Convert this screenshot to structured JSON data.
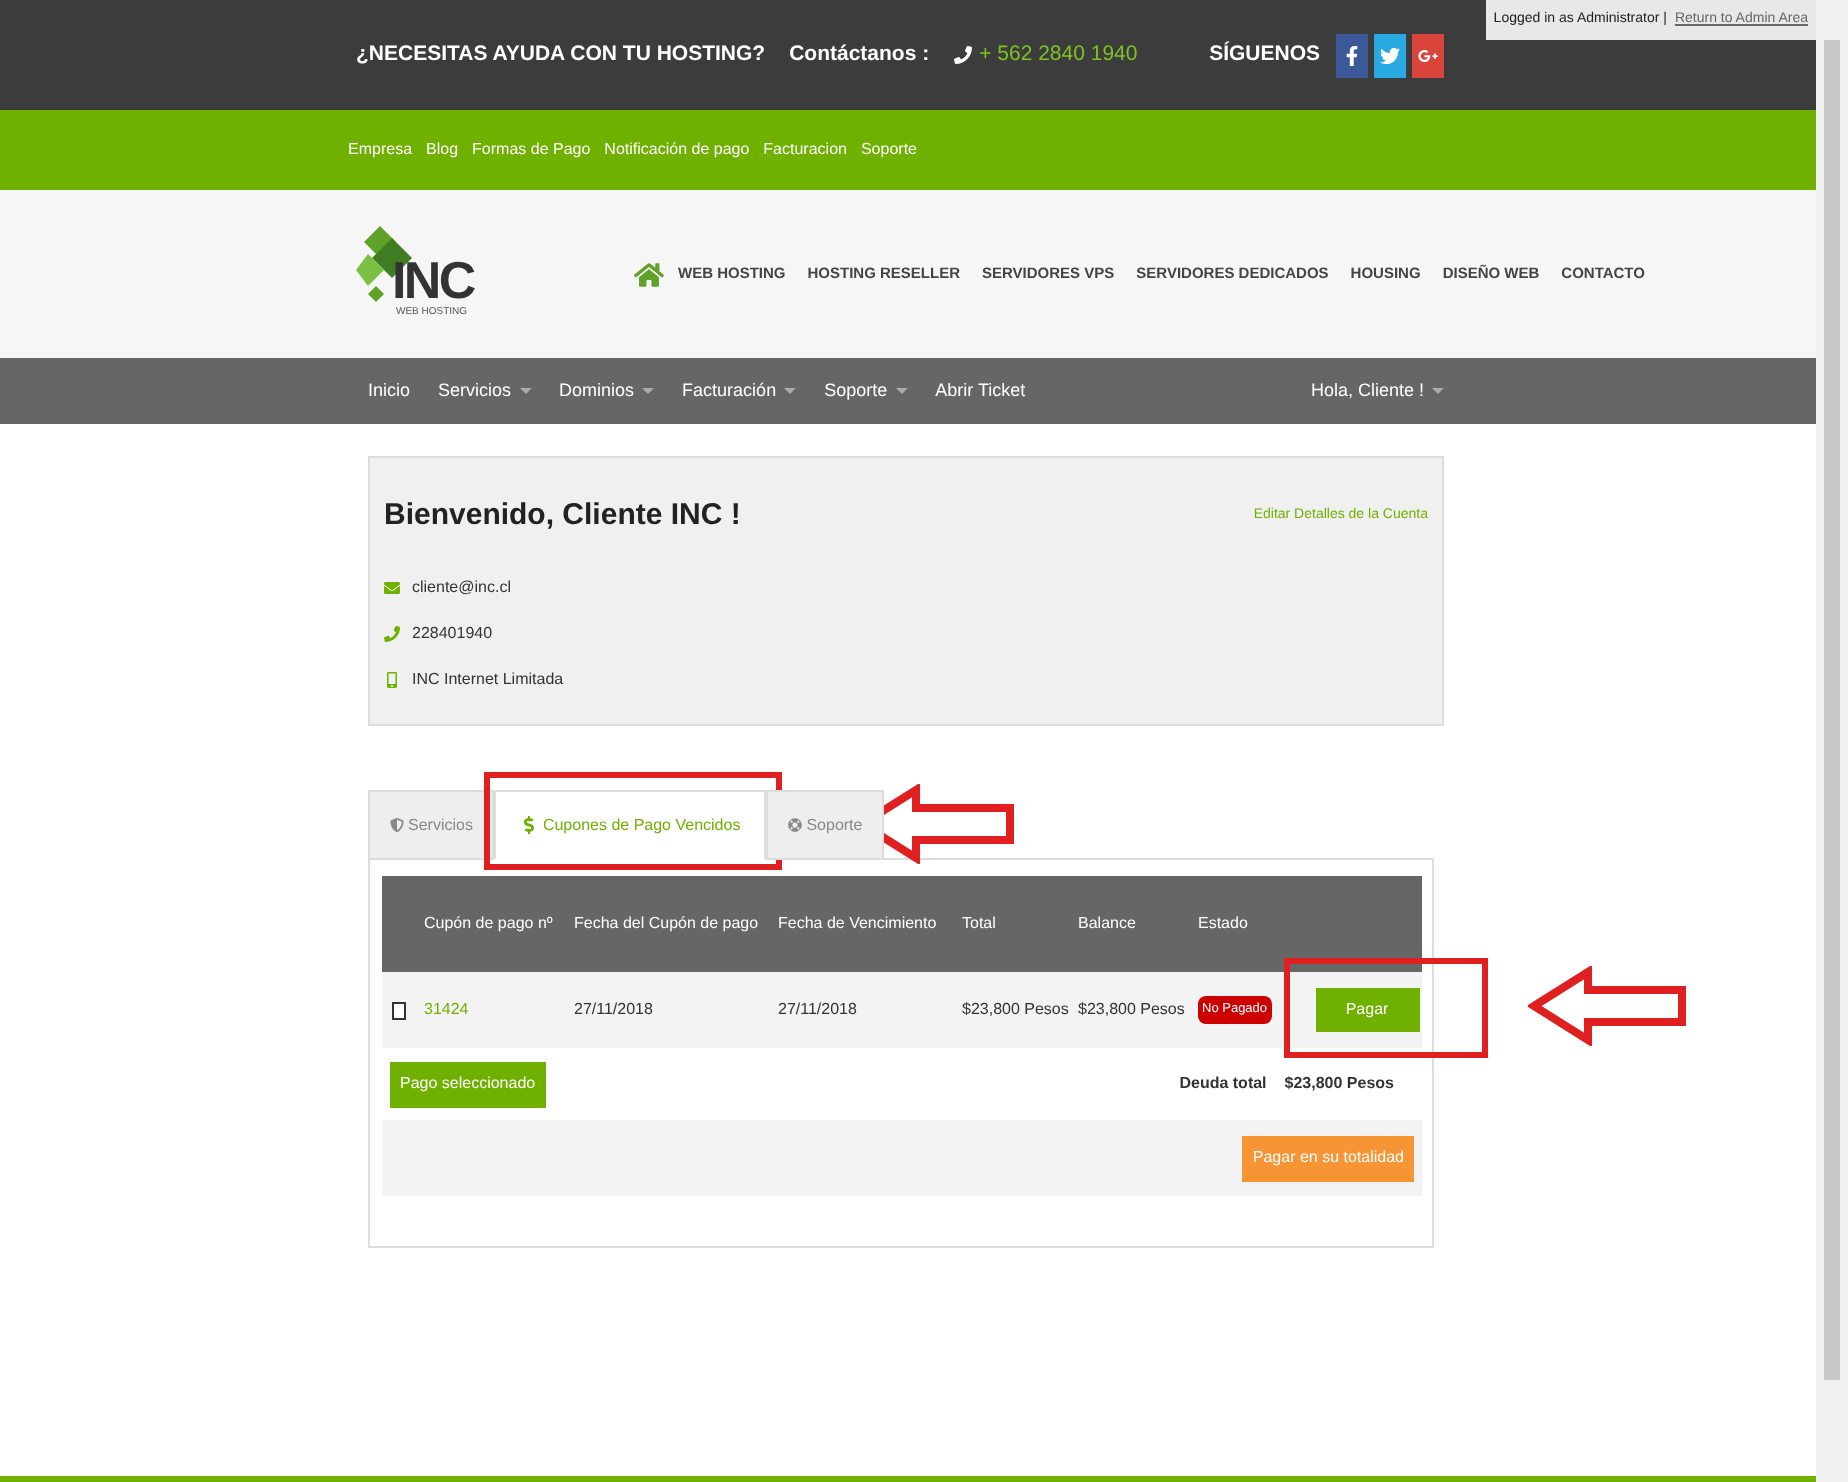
{
  "top_bar": {
    "help": "¿NECESITAS AYUDA CON TU HOSTING?",
    "contact_label": "Contáctanos :",
    "phone": "+ 562 2840 1940",
    "follow_label": "SÍGUENOS",
    "social": [
      {
        "kind": "facebook"
      },
      {
        "kind": "twitter"
      },
      {
        "kind": "googleplus"
      }
    ]
  },
  "admin_notice": {
    "text": "Logged in as Administrator |",
    "link": "Return to Admin Area"
  },
  "top_menu": [
    "Empresa",
    "Blog",
    "Formas de Pago",
    "Notificación de pago",
    "Facturacion",
    "Soporte"
  ],
  "logo": {
    "name": "INC",
    "tagline": "WEB HOSTING"
  },
  "main_menu": [
    "WEB HOSTING",
    "HOSTING RESELLER",
    "SERVIDORES VPS",
    "SERVIDORES DEDICADOS",
    "HOUSING",
    "DISEÑO WEB",
    "CONTACTO"
  ],
  "client_nav": {
    "items": [
      {
        "label": "Inicio",
        "dropdown": false
      },
      {
        "label": "Servicios",
        "dropdown": true
      },
      {
        "label": "Dominios",
        "dropdown": true
      },
      {
        "label": "Facturación",
        "dropdown": true
      },
      {
        "label": "Soporte",
        "dropdown": true
      },
      {
        "label": "Abrir Ticket",
        "dropdown": false
      }
    ],
    "user": {
      "label": "Hola, Cliente !",
      "dropdown": true
    }
  },
  "welcome": {
    "title": "Bienvenido, Cliente INC !",
    "edit_link": "Editar Detalles de la Cuenta",
    "details": [
      {
        "kind": "email",
        "text": "cliente@inc.cl"
      },
      {
        "kind": "phone",
        "text": "228401940"
      },
      {
        "kind": "company",
        "text": "INC Internet Limitada"
      }
    ]
  },
  "tabs": [
    {
      "kind": "services",
      "label": "Servicios",
      "selected": false,
      "highlighted": false
    },
    {
      "kind": "invoices",
      "label": "Cupones de Pago Vencidos",
      "selected": true,
      "highlighted": true
    },
    {
      "kind": "support",
      "label": "Soporte",
      "selected": false,
      "highlighted": false
    }
  ],
  "table": {
    "columns": [
      "Cupón de pago nº",
      "Fecha del Cupón de pago",
      "Fecha de Vencimiento",
      "Total",
      "Balance",
      "Estado"
    ],
    "rows": [
      {
        "checked": false,
        "number": "31424",
        "date": "27/11/2018",
        "due": "27/11/2018",
        "total": "$23,800 Pesos",
        "balance": "$23,800 Pesos",
        "status": "No Pagado",
        "action": "Pagar",
        "highlighted": true
      }
    ]
  },
  "pay_selected": "Pago seleccionado",
  "total_label": "Deuda total",
  "total_value": "$23,800 Pesos",
  "pay_all": "Pagar en su totalidad"
}
